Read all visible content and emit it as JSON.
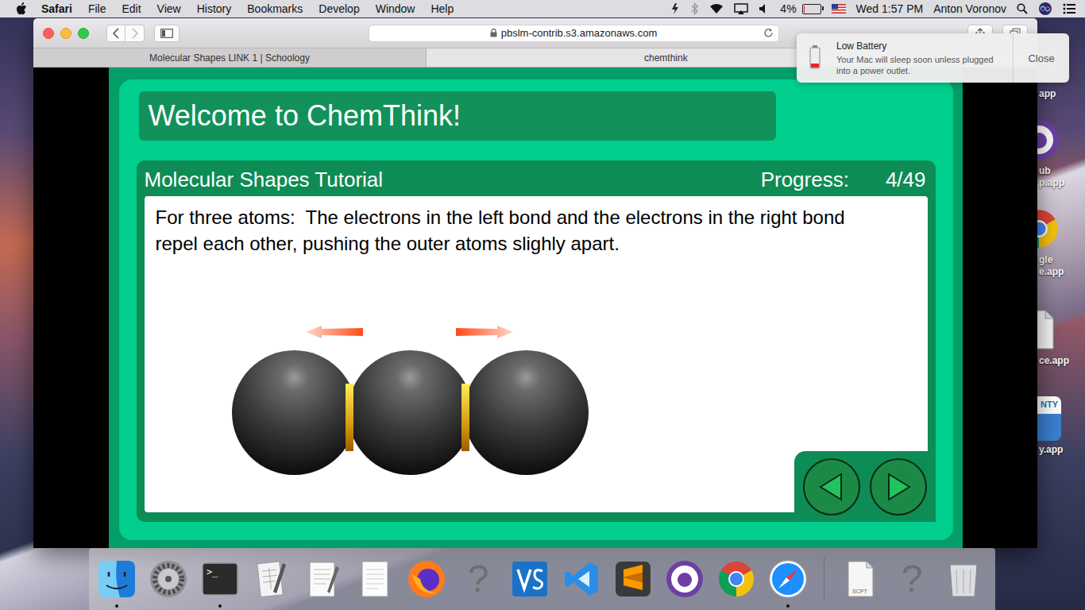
{
  "menu_bar": {
    "app": "Safari",
    "items": [
      "File",
      "Edit",
      "View",
      "History",
      "Bookmarks",
      "Develop",
      "Window",
      "Help"
    ],
    "battery": {
      "reading": "4%",
      "level": 0.04
    },
    "clock": "Wed 1:57 PM",
    "user": "Anton Voronov"
  },
  "browser": {
    "address": "pbslm-contrib.s3.amazonaws.com",
    "tabs": [
      {
        "label": "Molecular Shapes LINK 1 | Schoology",
        "selected": false
      },
      {
        "label": "chemthink",
        "selected": true
      }
    ]
  },
  "page": {
    "title": "Welcome to ChemThink!",
    "tutorial": "Molecular Shapes Tutorial",
    "progress_label": "Progress:",
    "progress": "4/49",
    "text": "For three atoms:  The electrons in the left bond and the electrons in the right bond repel each other, pushing the outer atoms slighly apart.",
    "molecule": {
      "atoms": 3
    },
    "nav": [
      {
        "kind": "back"
      },
      {
        "kind": "forward"
      }
    ]
  },
  "notification": {
    "title": "Low Battery",
    "lines": [
      "Your Mac will sleep soon unless plugged",
      "into a power outlet."
    ],
    "button": "Close"
  },
  "desktop_icons": [
    {
      "kind": "app",
      "lines": [
        "app"
      ],
      "badge": ""
    },
    {
      "kind": "github",
      "lines": [
        "ub",
        "p.app"
      ],
      "badge": ""
    },
    {
      "kind": "chrome",
      "lines": [
        "gle",
        "e.app"
      ],
      "badge": ""
    },
    {
      "kind": "document",
      "lines": [
        "ce.app"
      ],
      "badge": ""
    },
    {
      "kind": "badge",
      "lines": [
        "y.app"
      ],
      "badge": "NTY"
    }
  ],
  "dock": {
    "items": [
      {
        "kind": "finder",
        "running": true,
        "glyph": ""
      },
      {
        "kind": "prefs",
        "running": false,
        "glyph": ""
      },
      {
        "kind": "terminal",
        "running": true,
        "glyph": ">_"
      },
      {
        "kind": "script",
        "running": false,
        "glyph": ""
      },
      {
        "kind": "textedit",
        "running": false,
        "glyph": ""
      },
      {
        "kind": "notes",
        "running": false,
        "glyph": ""
      },
      {
        "kind": "firefox",
        "running": false,
        "glyph": ""
      },
      {
        "kind": "unknown",
        "running": false,
        "glyph": "?"
      },
      {
        "kind": "vs",
        "running": false,
        "glyph": ""
      },
      {
        "kind": "vscode",
        "running": false,
        "glyph": ""
      },
      {
        "kind": "sublime",
        "running": false,
        "glyph": ""
      },
      {
        "kind": "github",
        "running": false,
        "glyph": ""
      },
      {
        "kind": "chrome",
        "running": false,
        "glyph": ""
      },
      {
        "kind": "safari",
        "running": true,
        "glyph": ""
      },
      {
        "kind": "separator",
        "running": false,
        "glyph": ""
      },
      {
        "kind": "file",
        "running": false,
        "glyph": "SCPT"
      },
      {
        "kind": "unknown",
        "running": false,
        "glyph": "?"
      },
      {
        "kind": "trash",
        "running": false,
        "glyph": ""
      }
    ]
  }
}
